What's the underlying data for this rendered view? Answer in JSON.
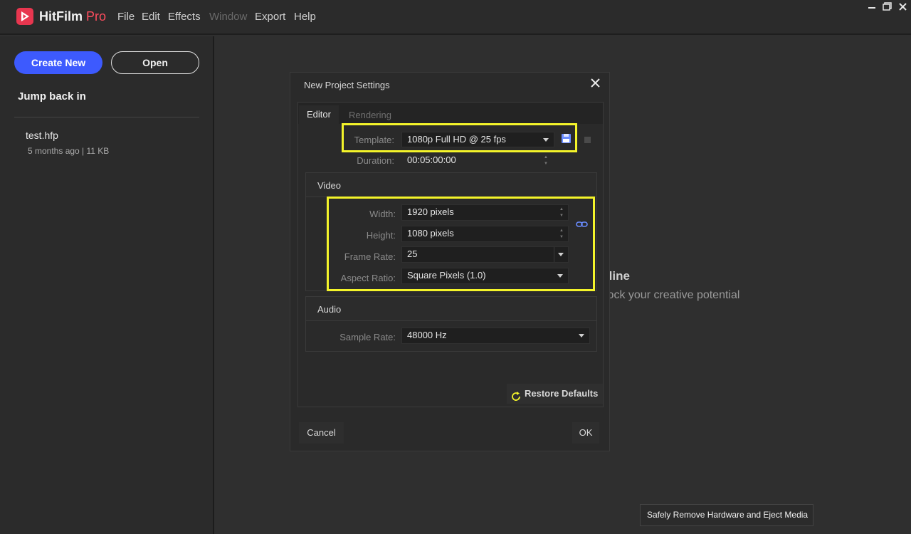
{
  "app": {
    "brand_main": "HitFilm",
    "brand_accent": "Pro",
    "menu": [
      "File",
      "Edit",
      "Effects",
      "Window",
      "Export",
      "Help"
    ],
    "menu_disabled": [
      "Window"
    ],
    "window_controls": [
      "minimize",
      "restore",
      "close"
    ]
  },
  "sidebar": {
    "create_new": "Create New",
    "open": "Open",
    "jump_back": "Jump back in",
    "recent": [
      {
        "name": "test.hfp",
        "meta": "5 months ago | 11 KB"
      }
    ]
  },
  "background": {
    "title_fragment": "fline",
    "subtitle_fragment": "lock your creative potential"
  },
  "dialog": {
    "title": "New Project Settings",
    "tabs": {
      "editor": "Editor",
      "rendering": "Rendering"
    },
    "template": {
      "label": "Template:",
      "value": "1080p Full HD @ 25 fps"
    },
    "duration": {
      "label": "Duration:",
      "value": "00:05:00:00"
    },
    "video": {
      "title": "Video",
      "width": {
        "label": "Width:",
        "value": "1920 pixels"
      },
      "height": {
        "label": "Height:",
        "value": "1080 pixels"
      },
      "frame_rate": {
        "label": "Frame Rate:",
        "value": "25"
      },
      "aspect_ratio": {
        "label": "Aspect Ratio:",
        "value": "Square Pixels (1.0)"
      }
    },
    "audio": {
      "title": "Audio",
      "sample_rate": {
        "label": "Sample Rate:",
        "value": "48000 Hz"
      }
    },
    "restore_defaults": "Restore Defaults",
    "cancel": "Cancel",
    "ok": "OK"
  },
  "tooltip": "Safely Remove Hardware and Eject Media",
  "colors": {
    "accent_blue": "#3d5afe",
    "brand_red": "#e8364f",
    "highlight_yellow": "#f4f42a",
    "icon_blue": "#6a8cff"
  }
}
